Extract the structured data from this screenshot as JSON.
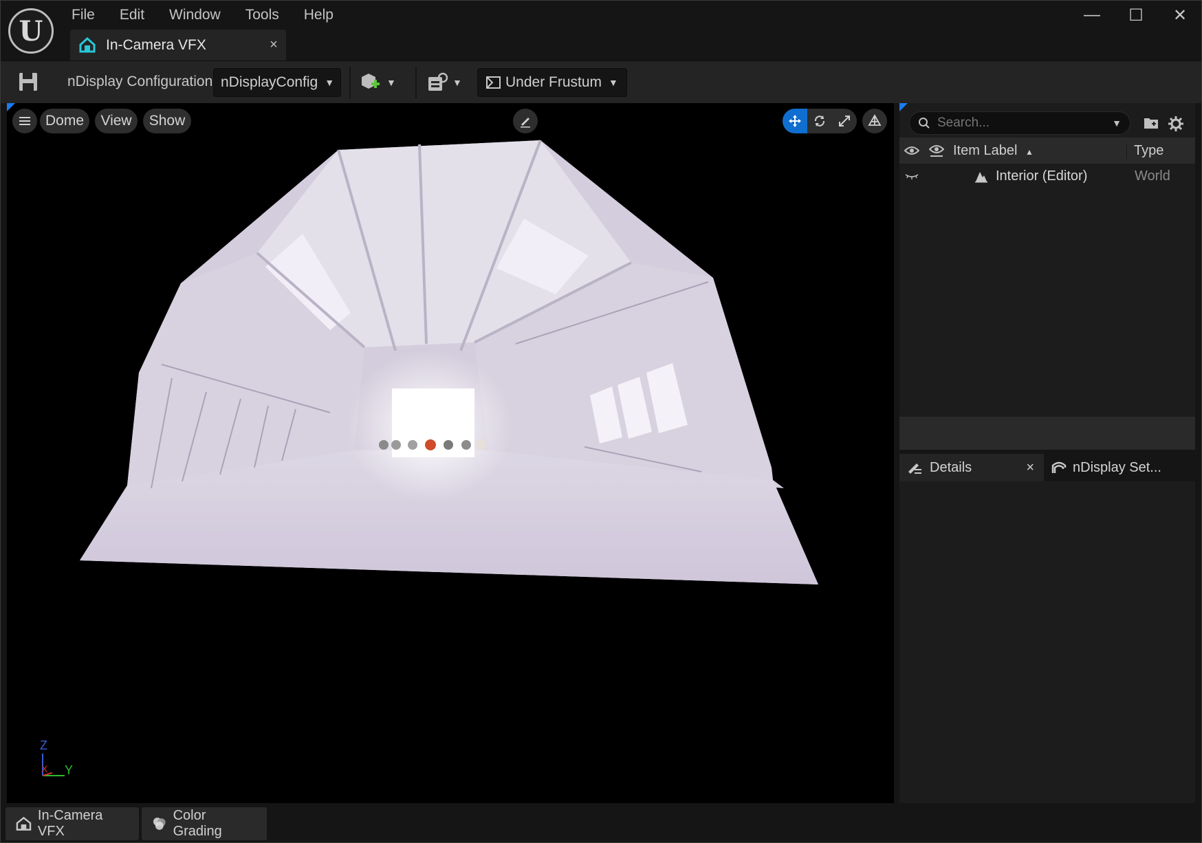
{
  "menu": {
    "items": [
      "File",
      "Edit",
      "Window",
      "Tools",
      "Help"
    ]
  },
  "window": {
    "minimize": "—",
    "maximize": "☐",
    "close": "✕"
  },
  "document_tab": {
    "label": "In-Camera VFX",
    "close": "×"
  },
  "toolbar": {
    "config_label": "nDisplay Configuration",
    "config_combo": "nDisplayConfig",
    "frustum_combo": "Under Frustum"
  },
  "viewport": {
    "menu_items": [
      "Dome",
      "View",
      "Show"
    ],
    "axis_z": "Z",
    "axis_y": "Y",
    "axis_x": "X"
  },
  "outliner": {
    "search_placeholder": "Search...",
    "columns": {
      "label": "Item Label",
      "sort": "▲",
      "type": "Type"
    },
    "rows": [
      {
        "label": "Interior (Editor)",
        "type": "World"
      }
    ]
  },
  "details": {
    "tabs": [
      {
        "label": "Details",
        "close": "×"
      },
      {
        "label": "nDisplay Set..."
      }
    ]
  },
  "bottom_tabs": [
    {
      "label": "In-Camera VFX"
    },
    {
      "label": "Color Grading"
    }
  ],
  "colors": {
    "accent": "#1a7cf0",
    "active_button": "#0f6ecf",
    "tab_icon": "#28c8d8"
  },
  "icons": {
    "logo": "unreal-logo",
    "save": "save-icon",
    "add_actor": "add-actor-icon",
    "blueprint": "blueprint-icon",
    "frustum": "frustum-icon"
  }
}
